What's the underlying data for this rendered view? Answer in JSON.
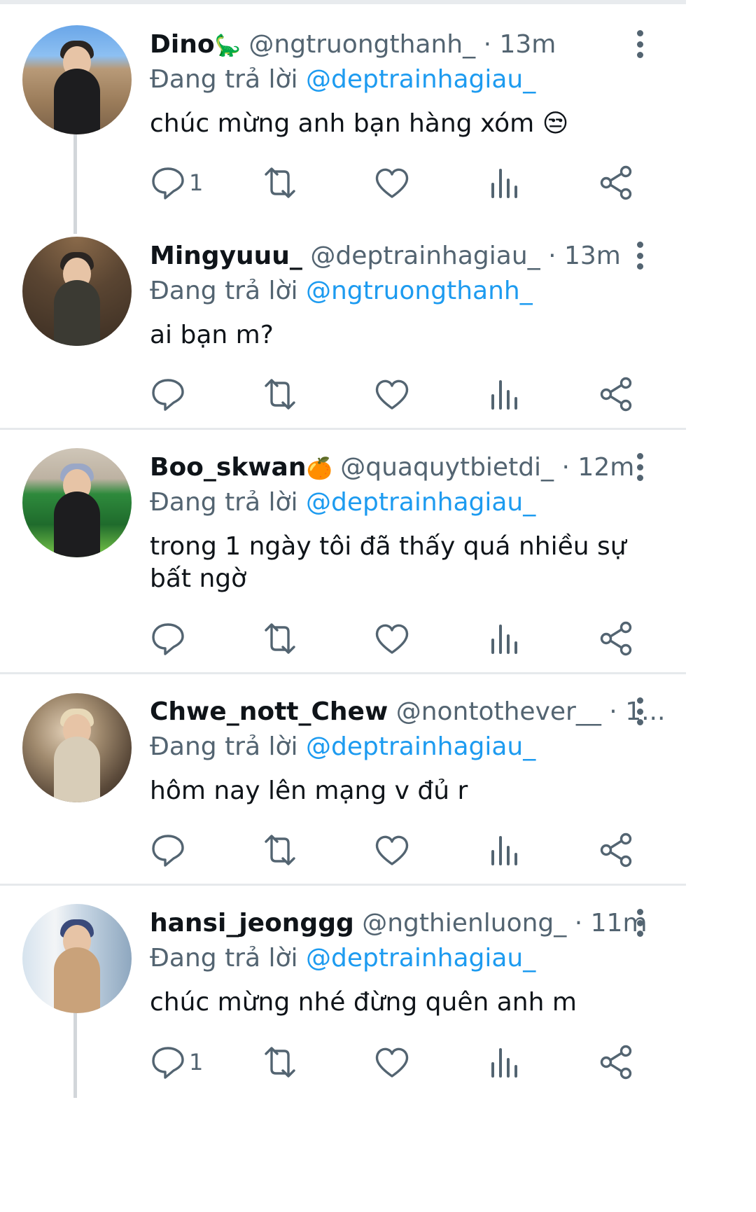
{
  "reply_prefix": "Đang trả lời",
  "colors": {
    "accent": "#1d9bf0",
    "muted": "#536471",
    "text": "#0f1419"
  },
  "icons": [
    "reply-icon",
    "retweet-icon",
    "like-icon",
    "views-icon",
    "share-icon",
    "more-icon"
  ],
  "tweets": [
    {
      "name": "Dino",
      "badge": "🦕",
      "handle": "@ngtruongthanh_",
      "time": "13m",
      "reply_to": "@deptrainhagiau_",
      "text": "chúc mừng anh bạn hàng xóm 😒",
      "reply_count": "1"
    },
    {
      "name": "Mingyuuu_",
      "badge": "",
      "handle": "@deptrainhagiau_",
      "time": "13m",
      "reply_to": "@ngtruongthanh_",
      "text": "ai bạn m?",
      "reply_count": ""
    },
    {
      "name": "Boo_skwan",
      "badge": "🍊",
      "handle": "@quaquytbietdi_",
      "time": "12m",
      "reply_to": "@deptrainhagiau_",
      "text": "trong 1 ngày tôi đã thấy quá nhiều sự bất ngờ",
      "reply_count": ""
    },
    {
      "name": "Chwe_nott_Chew",
      "badge": "",
      "handle": "@nontothever__",
      "time": "1...",
      "reply_to": "@deptrainhagiau_",
      "text": "hôm nay lên mạng v đủ r",
      "reply_count": ""
    },
    {
      "name": "hansi_jeonggg",
      "badge": "",
      "handle": "@ngthienluong_",
      "time": "11m",
      "reply_to": "@deptrainhagiau_",
      "text": "chúc mừng nhé đừng quên anh m",
      "reply_count": "1"
    }
  ]
}
